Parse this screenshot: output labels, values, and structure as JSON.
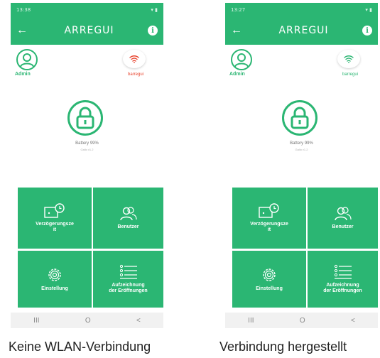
{
  "phones": [
    {
      "status_time": "13:38",
      "app_logo": "ARREGUI",
      "user_label": "Admin",
      "wifi_ssid": "barregui",
      "wifi_color": "#e8442e",
      "battery": "Battery 99%",
      "firmware": "Gallo v1.2",
      "tiles": [
        "Verzögerungsze\nit",
        "Benutzer",
        "Einstellung",
        "Aufzeichnung\nder Eröffnungen"
      ],
      "nav": [
        "III",
        "O",
        "<"
      ],
      "caption": "Keine WLAN-Verbindung"
    },
    {
      "status_time": "13:27",
      "app_logo": "ARREGUI",
      "user_label": "Admin",
      "wifi_ssid": "barregui",
      "wifi_color": "#2bb673",
      "battery": "Battery 99%",
      "firmware": "Gallo v1.2",
      "tiles": [
        "Verzögerungsze\nit",
        "Benutzer",
        "Einstellung",
        "Aufzeichnung\nder Eröffnungen"
      ],
      "nav": [
        "III",
        "O",
        "<"
      ],
      "caption": "Verbindung hergestellt"
    }
  ],
  "colors": {
    "accent": "#2bb673"
  },
  "icons": [
    "back-arrow-icon",
    "info-icon",
    "user-icon",
    "wifi-icon",
    "lock-icon",
    "delay-clock-icon",
    "users-icon",
    "gear-icon",
    "list-icon"
  ]
}
